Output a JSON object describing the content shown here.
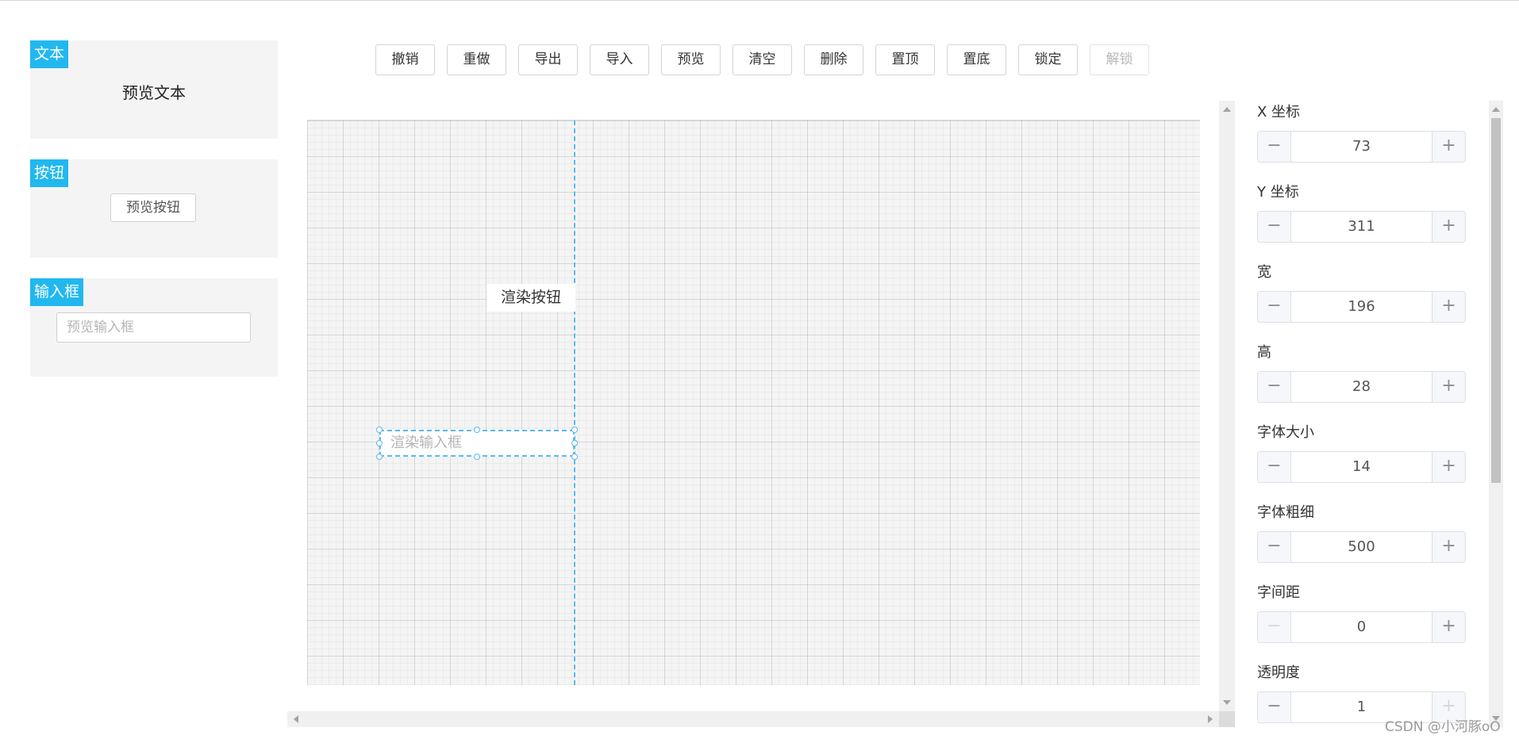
{
  "palette": {
    "text_card": {
      "tag": "文本",
      "preview": "预览文本"
    },
    "button_card": {
      "tag": "按钮",
      "preview": "预览按钮"
    },
    "input_card": {
      "tag": "输入框",
      "placeholder": "预览输入框"
    }
  },
  "toolbar": {
    "undo": "撤销",
    "redo": "重做",
    "export": "导出",
    "import": "导入",
    "preview": "预览",
    "clear": "清空",
    "delete": "删除",
    "bring_to_top": "置顶",
    "send_to_bottom": "置底",
    "lock": "锁定",
    "unlock": "解锁",
    "unlock_disabled": true
  },
  "canvas": {
    "render_button": "渲染按钮",
    "render_input_placeholder": "渲染输入框",
    "guide_color": "#5ab9f2"
  },
  "properties": {
    "x": {
      "label": "X 坐标",
      "value": "73"
    },
    "y": {
      "label": "Y 坐标",
      "value": "311"
    },
    "width": {
      "label": "宽",
      "value": "196"
    },
    "height": {
      "label": "高",
      "value": "28"
    },
    "font_size": {
      "label": "字体大小",
      "value": "14"
    },
    "font_weight": {
      "label": "字体粗细",
      "value": "500"
    },
    "letter_spacing": {
      "label": "字间距",
      "value": "0",
      "minus_disabled": true
    },
    "opacity": {
      "label": "透明度",
      "value": "1",
      "plus_disabled": true
    }
  },
  "icons": {
    "minus": "−",
    "plus": "+"
  },
  "colors": {
    "accent": "#21b8ef",
    "panel_bg": "#f4f4f4"
  },
  "watermark": "CSDN @小河豚oO"
}
